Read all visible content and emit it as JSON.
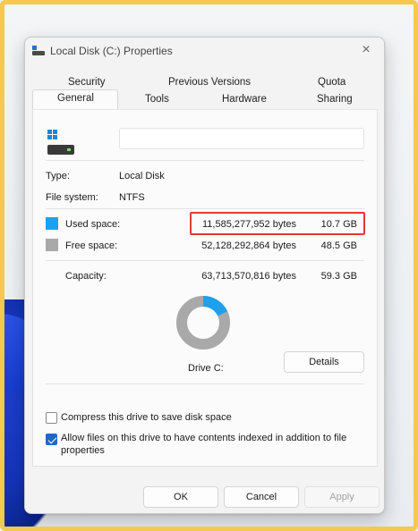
{
  "dialog": {
    "title": "Local Disk (C:) Properties",
    "close_glyph": "×",
    "title_icon": "drive-icon"
  },
  "tabs": {
    "row1": [
      "Security",
      "Previous Versions",
      "Quota"
    ],
    "row2": [
      "General",
      "Tools",
      "Hardware",
      "Sharing"
    ],
    "active": "General"
  },
  "general": {
    "volume_label_value": "",
    "type_label": "Type:",
    "type_value": "Local Disk",
    "filesystem_label": "File system:",
    "filesystem_value": "NTFS",
    "used": {
      "label": "Used space:",
      "bytes": "11,585,277,952 bytes",
      "size": "10.7 GB",
      "color": "#1fa0ec"
    },
    "free": {
      "label": "Free space:",
      "bytes": "52,128,292,864 bytes",
      "size": "48.5 GB",
      "color": "#a9a9a9"
    },
    "capacity": {
      "label": "Capacity:",
      "bytes": "63,713,570,816 bytes",
      "size": "59.3 GB"
    },
    "used_fraction": 0.18,
    "drive_label": "Drive C:",
    "details_button": "Details"
  },
  "options": {
    "compress_label": "Compress this drive to save disk space",
    "compress_checked": false,
    "index_label_line1": "Allow files on this drive to have contents indexed in addition to file",
    "index_label_line2": "properties",
    "index_checked": true
  },
  "footer": {
    "ok": "OK",
    "cancel": "Cancel",
    "apply": "Apply"
  },
  "highlight_color": "#e23a3a"
}
